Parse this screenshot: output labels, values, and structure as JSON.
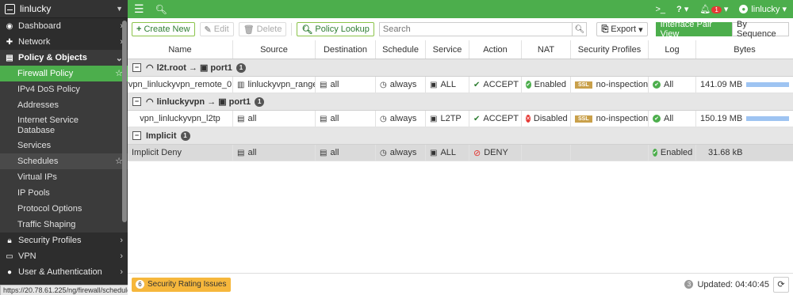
{
  "brand": {
    "device_name": "linlucky"
  },
  "sidebar": {
    "items": [
      {
        "label": "Dashboard",
        "icon": "dashboard-icon"
      },
      {
        "label": "Network",
        "icon": "network-icon"
      },
      {
        "label": "Policy & Objects",
        "icon": "policy-icon"
      }
    ],
    "sub_items": [
      {
        "label": "Firewall Policy"
      },
      {
        "label": "IPv4 DoS Policy"
      },
      {
        "label": "Addresses"
      },
      {
        "label": "Internet Service Database"
      },
      {
        "label": "Services"
      },
      {
        "label": "Schedules"
      },
      {
        "label": "Virtual IPs"
      },
      {
        "label": "IP Pools"
      },
      {
        "label": "Protocol Options"
      },
      {
        "label": "Traffic Shaping"
      }
    ],
    "bottom_items": [
      {
        "label": "Security Profiles",
        "icon": "lock-icon"
      },
      {
        "label": "VPN",
        "icon": "vpn-icon"
      },
      {
        "label": "User & Authentication",
        "icon": "user-icon"
      }
    ]
  },
  "status_url": "https://20.78.61.225/ng/firewall/schedule",
  "topbar": {
    "username": "linlucky",
    "notifications": "1",
    "help_label": "?"
  },
  "toolbar": {
    "create_new": "Create New",
    "edit": "Edit",
    "delete": "Delete",
    "policy_lookup": "Policy Lookup",
    "search_placeholder": "Search",
    "export": "Export",
    "interface_pair_view": "Interface Pair View",
    "by_sequence": "By Sequence"
  },
  "table": {
    "headers": [
      "Name",
      "Source",
      "Destination",
      "Schedule",
      "Service",
      "Action",
      "NAT",
      "Security Profiles",
      "Log",
      "Bytes"
    ],
    "groups": [
      {
        "from": "l2t.root",
        "to": "port1",
        "count": "1",
        "rows": [
          {
            "name": "vpn_linluckyvpn_remote_0",
            "source": "linluckyvpn_range",
            "destination": "all",
            "schedule": "always",
            "service": "ALL",
            "action": "ACCEPT",
            "nat": "Enabled",
            "profile_badge": "SSL",
            "profile": "no-inspection",
            "log": "All",
            "bytes": "141.09 MB",
            "bytes_fill": 1.0
          }
        ]
      },
      {
        "from": "linluckyvpn",
        "to": "port1",
        "count": "1",
        "rows": [
          {
            "name": "vpn_linluckyvpn_l2tp",
            "source": "all",
            "destination": "all",
            "schedule": "always",
            "service": "L2TP",
            "action": "ACCEPT",
            "nat": "Disabled",
            "profile_badge": "SSL",
            "profile": "no-inspection",
            "log": "All",
            "bytes": "150.19 MB",
            "bytes_fill": 1.0
          }
        ]
      },
      {
        "label": "Implicit",
        "count": "1",
        "rows": [
          {
            "name": "Implicit Deny",
            "source": "all",
            "destination": "all",
            "schedule": "always",
            "service": "ALL",
            "action": "DENY",
            "log": "Enabled",
            "bytes": "31.68 kB"
          }
        ]
      }
    ]
  },
  "footer": {
    "security_rating_count": "6",
    "security_rating_label": "Security Rating Issues",
    "updated_count": "3",
    "updated": "Updated: 04:40:45"
  },
  "colors": {
    "brand_green": "#4cae4c",
    "sidebar_bg": "#2d2d2d",
    "accent_red": "#e53935",
    "ssl_badge": "#c9a04a"
  }
}
